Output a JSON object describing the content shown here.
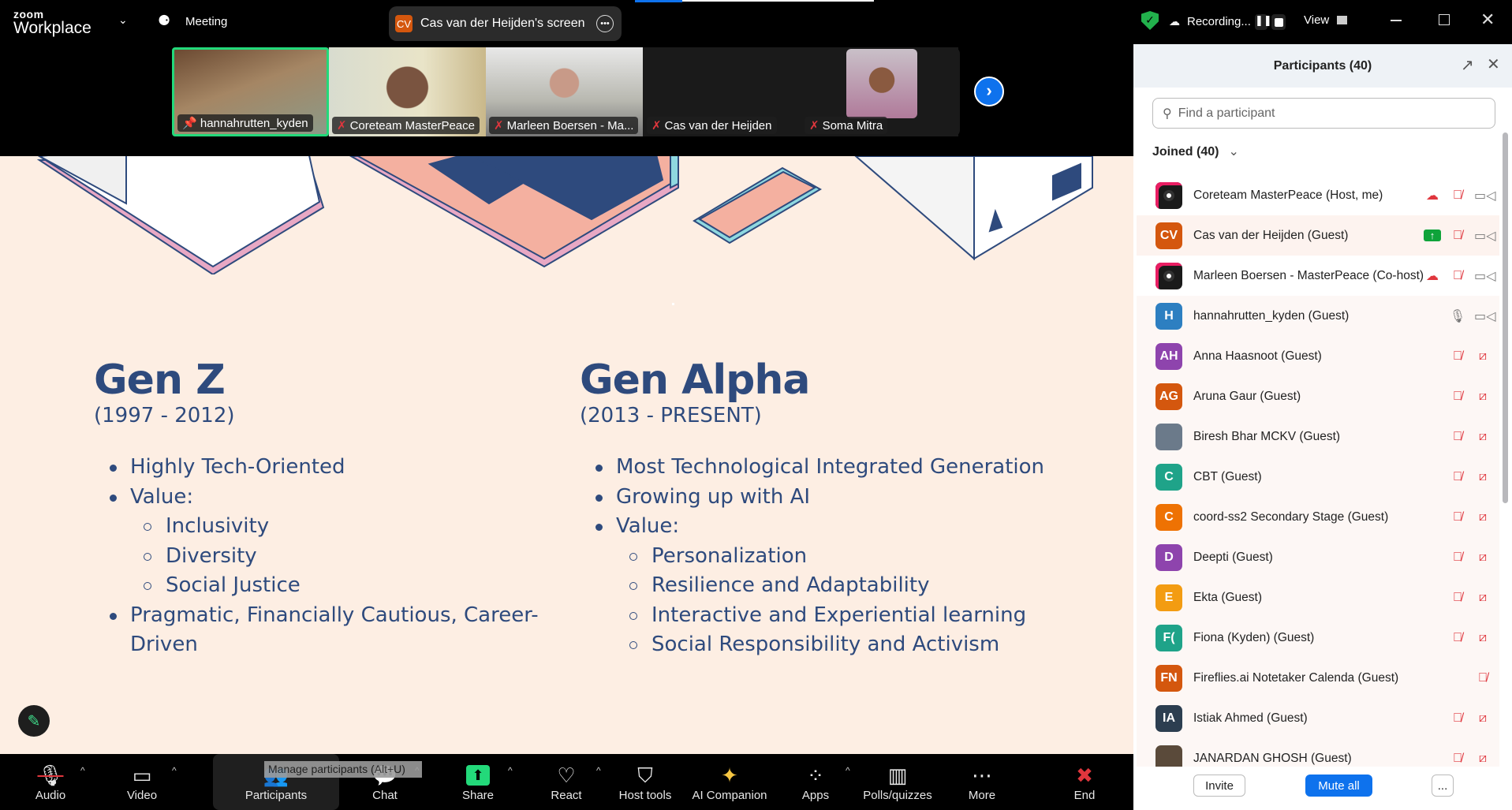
{
  "app": {
    "logo_top": "zoom",
    "logo_bottom": "Workplace",
    "meeting_label": "Meeting",
    "share_badge": "CV",
    "share_title": "Cas van der Heijden's screen",
    "recording_label": "Recording...",
    "view_label": "View"
  },
  "strip": {
    "thumbs": [
      {
        "name": "hannahrutten_kyden",
        "active": true,
        "muted": false
      },
      {
        "name": "Coreteam MasterPeace",
        "muted": true
      },
      {
        "name": "Marleen Boersen - Ma...",
        "muted": true
      },
      {
        "name": "Cas van der Heijden",
        "muted": true
      },
      {
        "name": "Soma Mitra",
        "muted": true
      }
    ]
  },
  "slide": {
    "left": {
      "title": "Gen Z",
      "subtitle": "(1997 - 2012)",
      "items": [
        {
          "t": "Highly Tech-Oriented",
          "l": 1
        },
        {
          "t": "Value:",
          "l": 1
        },
        {
          "t": "Inclusivity",
          "l": 2
        },
        {
          "t": "Diversity",
          "l": 2
        },
        {
          "t": "Social Justice",
          "l": 2
        },
        {
          "t": "Pragmatic, Financially Cautious, Career-",
          "l": 1
        },
        {
          "t": "Driven",
          "l": 0
        }
      ]
    },
    "right": {
      "title": "Gen Alpha",
      "subtitle": "(2013 - PRESENT)",
      "items": [
        {
          "t": "Most Technological Integrated Generation",
          "l": 1
        },
        {
          "t": "Growing up with AI",
          "l": 1
        },
        {
          "t": "Value:",
          "l": 1
        },
        {
          "t": "Personalization",
          "l": 2
        },
        {
          "t": "Resilience and Adaptability",
          "l": 2
        },
        {
          "t": "Interactive and Experiential learning",
          "l": 2
        },
        {
          "t": "Social Responsibility and Activism",
          "l": 2
        }
      ]
    }
  },
  "toolbar": {
    "items": [
      {
        "label": "Audio",
        "icon": "mic-muted-icon",
        "caret": true
      },
      {
        "label": "Video",
        "icon": "video-icon",
        "caret": true
      },
      {
        "label": "Participants",
        "icon": "participants-icon",
        "caret": true,
        "active": true
      },
      {
        "label": "Chat",
        "icon": "chat-icon",
        "caret": true
      },
      {
        "label": "Share",
        "icon": "share-icon",
        "caret": true
      },
      {
        "label": "React",
        "icon": "heart-icon",
        "caret": true
      },
      {
        "label": "Host tools",
        "icon": "shield-icon"
      },
      {
        "label": "AI Companion",
        "icon": "sparkle-icon"
      },
      {
        "label": "Apps",
        "icon": "apps-icon",
        "caret": true
      },
      {
        "label": "Polls/quizzes",
        "icon": "poll-icon"
      },
      {
        "label": "More",
        "icon": "more-icon"
      },
      {
        "label": "End",
        "icon": "end-icon"
      }
    ],
    "tooltip": "Manage participants (Alt+U)"
  },
  "panel": {
    "title": "Participants (40)",
    "search_placeholder": "Find a participant",
    "joined": "Joined (40)",
    "invite": "Invite",
    "mute_all": "Mute all",
    "more": "...",
    "participants": [
      {
        "initials": "",
        "name": "Coreteam MasterPeace (Host, me)",
        "color": "#1a1a1a",
        "extra": "cloud-record",
        "mic": "muted",
        "video": "on"
      },
      {
        "initials": "CV",
        "name": "Cas van der Heijden (Guest)",
        "color": "#d4570e",
        "extra": "sharing",
        "mic": "muted",
        "video": "on"
      },
      {
        "initials": "",
        "name": "Marleen Boersen - MasterPeace (Co-host)",
        "color": "#1a1a1a",
        "extra": "cloud-record",
        "mic": "muted",
        "video": "on"
      },
      {
        "initials": "H",
        "name": "hannahrutten_kyden (Guest)",
        "color": "#2d7fc1",
        "mic": "on",
        "video": "on"
      },
      {
        "initials": "AH",
        "name": "Anna Haasnoot (Guest)",
        "color": "#8e44ad",
        "mic": "muted",
        "video": "off"
      },
      {
        "initials": "AG",
        "name": "Aruna Gaur (Guest)",
        "color": "#d4570e",
        "mic": "muted",
        "video": "off"
      },
      {
        "initials": "",
        "name": "Biresh Bhar MCKV (Guest)",
        "color": "#6b7a8a",
        "mic": "muted",
        "video": "off"
      },
      {
        "initials": "C",
        "name": "CBT (Guest)",
        "color": "#1fa389",
        "mic": "muted",
        "video": "off"
      },
      {
        "initials": "C",
        "name": "coord-ss2 Secondary Stage (Guest)",
        "color": "#ee7203",
        "mic": "muted",
        "video": "off"
      },
      {
        "initials": "D",
        "name": "Deepti (Guest)",
        "color": "#8e44ad",
        "mic": "muted",
        "video": "off"
      },
      {
        "initials": "E",
        "name": "Ekta (Guest)",
        "color": "#f39c12",
        "mic": "muted",
        "video": "off"
      },
      {
        "initials": "F(",
        "name": "Fiona (Kyden) (Guest)",
        "color": "#1fa389",
        "mic": "muted",
        "video": "off"
      },
      {
        "initials": "FN",
        "name": "Fireflies.ai Notetaker Calenda (Guest)",
        "color": "#d4570e",
        "mic": "muted",
        "video": "none"
      },
      {
        "initials": "IA",
        "name": "Istiak Ahmed (Guest)",
        "color": "#2c3e50",
        "mic": "muted",
        "video": "off"
      },
      {
        "initials": "",
        "name": "JANARDAN GHOSH (Guest)",
        "color": "#5a4a3a",
        "mic": "muted",
        "video": "off"
      }
    ]
  },
  "colors": {
    "slide_bg": "#fdeee3",
    "slide_text": "#2e4a7d",
    "accent_blue": "#0e72ed",
    "active_speaker": "#23d97a",
    "muted_red": "#e0363d"
  }
}
